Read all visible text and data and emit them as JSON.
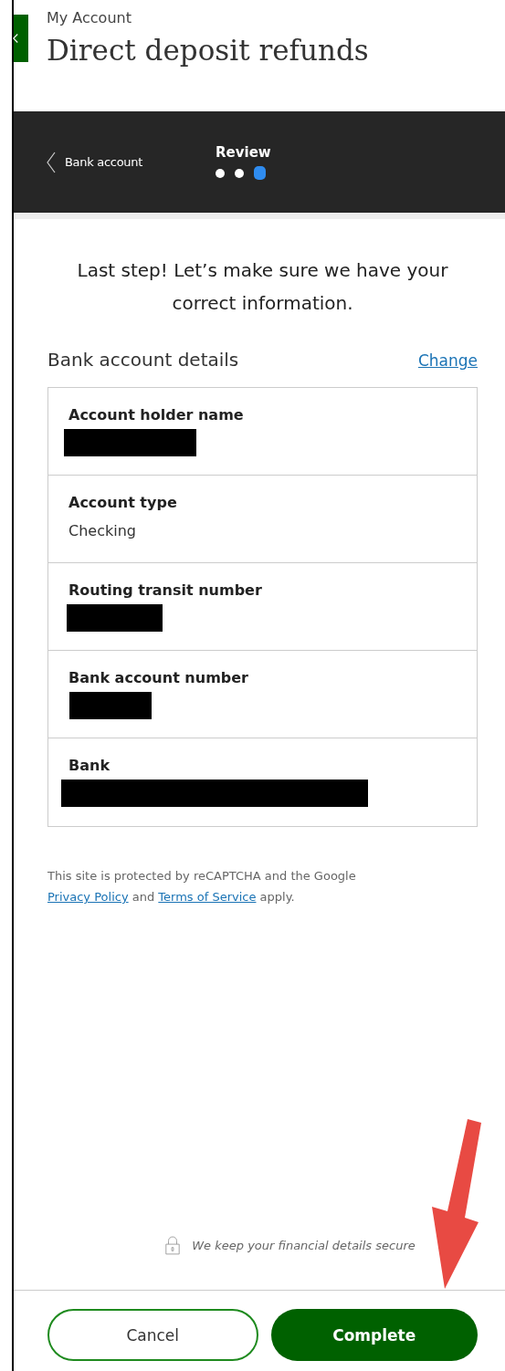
{
  "header": {
    "breadcrumb": "My Account",
    "title": "Direct deposit refunds"
  },
  "stepper": {
    "back_label": "Bank account",
    "current_step": "Review",
    "steps": [
      {
        "selected": false
      },
      {
        "selected": false
      },
      {
        "selected": true
      }
    ]
  },
  "intro": "Last step! Let’s make sure we have your correct information.",
  "details": {
    "heading": "Bank account details",
    "change_link": "Change",
    "fields": [
      {
        "label": "Account holder name",
        "kind": "redacted"
      },
      {
        "label": "Account type",
        "kind": "text",
        "value": "Checking"
      },
      {
        "label": "Routing transit number",
        "kind": "redacted"
      },
      {
        "label": "Bank account number",
        "kind": "redacted"
      },
      {
        "label": "Bank",
        "kind": "redacted"
      }
    ]
  },
  "recaptcha": {
    "text": "This site is protected by reCAPTCHA and the Google",
    "privacy_link": "Privacy Policy",
    "and": "and",
    "terms_link": "Terms of Service",
    "apply": "apply."
  },
  "secure_note": "We keep your financial details secure",
  "buttons": [
    {
      "label": "Cancel",
      "kind": "secondary"
    },
    {
      "label": "Complete",
      "kind": "primary"
    }
  ]
}
